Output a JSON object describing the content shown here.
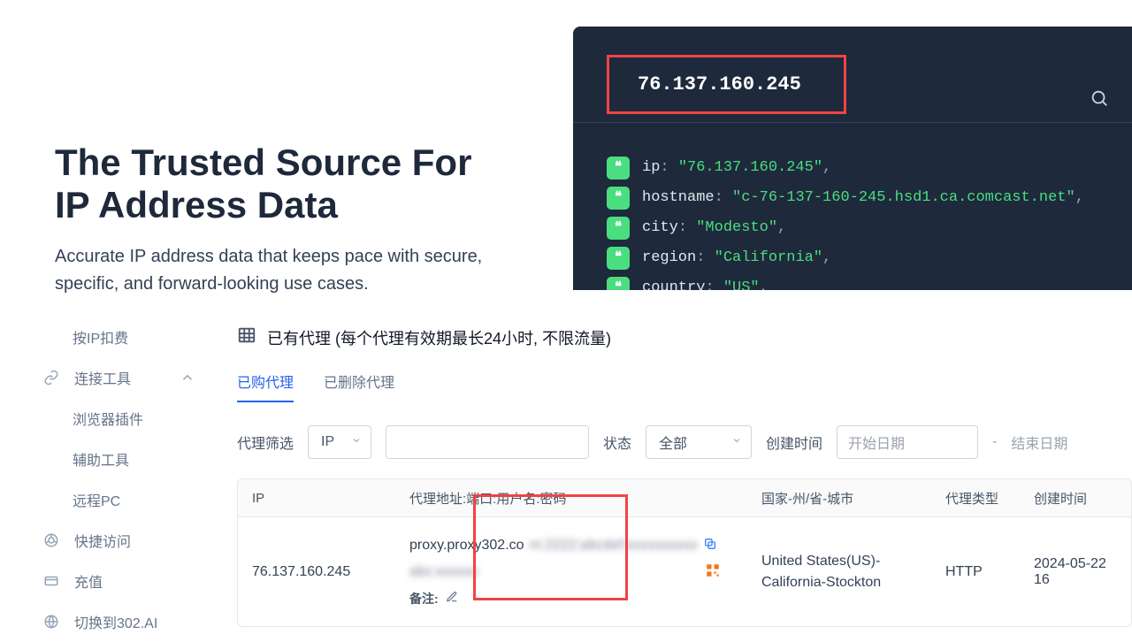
{
  "hero": {
    "title": "The Trusted Source For IP Address Data",
    "subtitle": "Accurate IP address data that keeps pace with secure, specific, and forward-looking use cases."
  },
  "dark": {
    "ip_display": "76.137.160.245",
    "search_placeholder": "Search",
    "rows": [
      {
        "key": "ip",
        "val": "\"76.137.160.245\""
      },
      {
        "key": "hostname",
        "val": "\"c-76-137-160-245.hsd1.ca.comcast.net\""
      },
      {
        "key": "city",
        "val": "\"Modesto\""
      },
      {
        "key": "region",
        "val": "\"California\""
      },
      {
        "key": "country",
        "val": "\"US\""
      }
    ]
  },
  "sidebar": {
    "items": {
      "ip_billing": "按IP扣费",
      "connect_tools": "连接工具",
      "browser_ext": "浏览器插件",
      "aux_tools": "辅助工具",
      "remote_pc": "远程PC",
      "quick_access": "快捷访问",
      "recharge": "充值",
      "switch_ai": "切换到302.AI"
    }
  },
  "main": {
    "title": "已有代理 (每个代理有效期最长24小时, 不限流量)",
    "tabs": {
      "purchased": "已购代理",
      "deleted": "已删除代理"
    },
    "filters": {
      "filter_label": "代理筛选",
      "ip_label": "IP",
      "status_label": "状态",
      "all_option": "全部",
      "create_time_label": "创建时间",
      "start_date": "开始日期",
      "end_date": "结束日期",
      "dash": "-"
    },
    "columns": {
      "ip": "IP",
      "addr": "代理地址:端口:用户名:密码",
      "loc": "国家-州/省-城市",
      "type": "代理类型",
      "time": "创建时间"
    },
    "row": {
      "ip": "76.137.160.245",
      "addr_prefix": "proxy.proxy302.co",
      "addr_blur1": "m:2222:abcdef:xxxxxxxxxx",
      "addr_blur2": "abc:xxxxxx",
      "remark_label": "备注:",
      "location": "United States(US)-California-Stockton",
      "type": "HTTP",
      "time": "2024-05-22 16"
    }
  }
}
